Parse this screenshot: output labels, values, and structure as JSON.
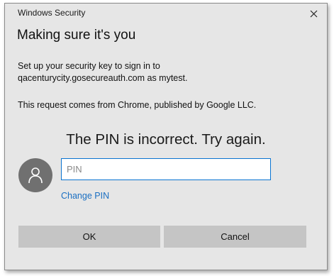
{
  "window": {
    "title": "Windows Security",
    "close_icon": "close-icon"
  },
  "dialog": {
    "heading": "Making sure it's you",
    "line1": "Set up your security key to sign in to",
    "line2": "qacenturycity.gosecureauth.com as mytest.",
    "line3": "This request comes from Chrome, published by Google LLC.",
    "error": "The PIN is incorrect. Try again.",
    "avatar_icon": "user-icon",
    "pin": {
      "value": "",
      "placeholder": "PIN"
    },
    "change_pin_label": "Change PIN",
    "ok_label": "OK",
    "cancel_label": "Cancel"
  },
  "colors": {
    "dialog_bg": "#e6e6e6",
    "button_bg": "#c5c5c5",
    "link": "#1a6fc2",
    "input_border": "#0a74d1",
    "avatar_bg": "#707070"
  }
}
